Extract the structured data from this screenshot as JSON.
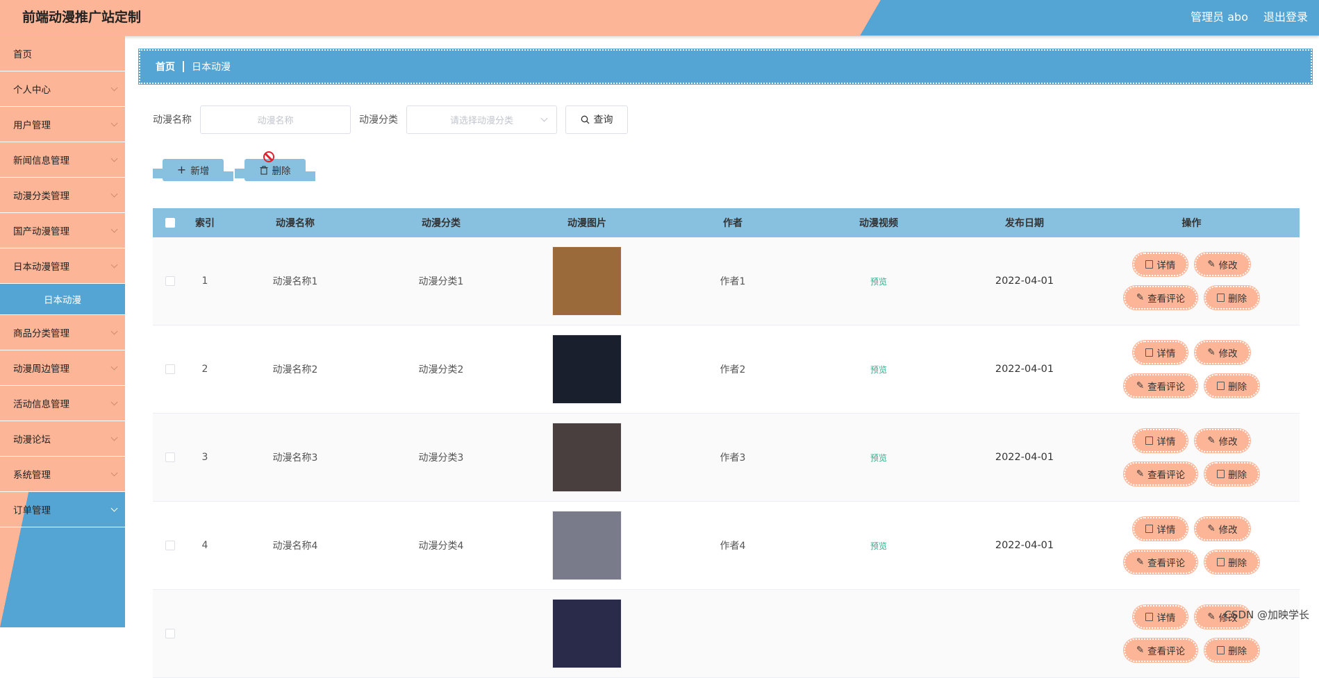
{
  "header": {
    "title": "前端动漫推广站定制",
    "user": "管理员 abo",
    "logout": "退出登录"
  },
  "sidebar": {
    "items": [
      {
        "label": "首页",
        "chevron": false
      },
      {
        "label": "个人中心",
        "chevron": true
      },
      {
        "label": "用户管理",
        "chevron": true
      },
      {
        "label": "新闻信息管理",
        "chevron": true
      },
      {
        "label": "动漫分类管理",
        "chevron": true
      },
      {
        "label": "国产动漫管理",
        "chevron": true
      },
      {
        "label": "日本动漫管理",
        "chevron": true
      },
      {
        "label": "日本动漫",
        "sub": true
      },
      {
        "label": "商品分类管理",
        "chevron": true
      },
      {
        "label": "动漫周边管理",
        "chevron": true
      },
      {
        "label": "活动信息管理",
        "chevron": true
      },
      {
        "label": "动漫论坛",
        "chevron": true
      },
      {
        "label": "系统管理",
        "chevron": true
      },
      {
        "label": "订单管理",
        "chevron": true
      }
    ]
  },
  "breadcrumb": {
    "home": "首页",
    "current": "日本动漫"
  },
  "search": {
    "name_label": "动漫名称",
    "name_placeholder": "动漫名称",
    "category_label": "动漫分类",
    "category_placeholder": "请选择动漫分类",
    "query_button": "查询"
  },
  "actions": {
    "add": "新增",
    "delete": "删除"
  },
  "table": {
    "headers": [
      "索引",
      "动漫名称",
      "动漫分类",
      "动漫图片",
      "作者",
      "动漫视频",
      "发布日期",
      "操作"
    ],
    "rows": [
      {
        "index": "1",
        "name": "动漫名称1",
        "category": "动漫分类1",
        "author": "作者1",
        "video": "预览",
        "date": "2022-04-01",
        "thumb_color": "#9a6a3a"
      },
      {
        "index": "2",
        "name": "动漫名称2",
        "category": "动漫分类2",
        "author": "作者2",
        "video": "预览",
        "date": "2022-04-01",
        "thumb_color": "#1a1f2e"
      },
      {
        "index": "3",
        "name": "动漫名称3",
        "category": "动漫分类3",
        "author": "作者3",
        "video": "预览",
        "date": "2022-04-01",
        "thumb_color": "#4a3f3f"
      },
      {
        "index": "4",
        "name": "动漫名称4",
        "category": "动漫分类4",
        "author": "作者4",
        "video": "预览",
        "date": "2022-04-01",
        "thumb_color": "#7a7b8a"
      },
      {
        "index": "",
        "name": "",
        "category": "",
        "author": "",
        "video": "",
        "date": "",
        "thumb_color": "#2a2a4a"
      }
    ],
    "op_buttons": {
      "detail": "详情",
      "edit": "修改",
      "comments": "查看评论",
      "delete": "删除"
    }
  },
  "watermark": "CSDN @加映学长",
  "colors": {
    "peach": "#fcb597",
    "blue": "#55a5d4",
    "table_header": "#88c0e0",
    "link_green": "#2ab08a"
  }
}
